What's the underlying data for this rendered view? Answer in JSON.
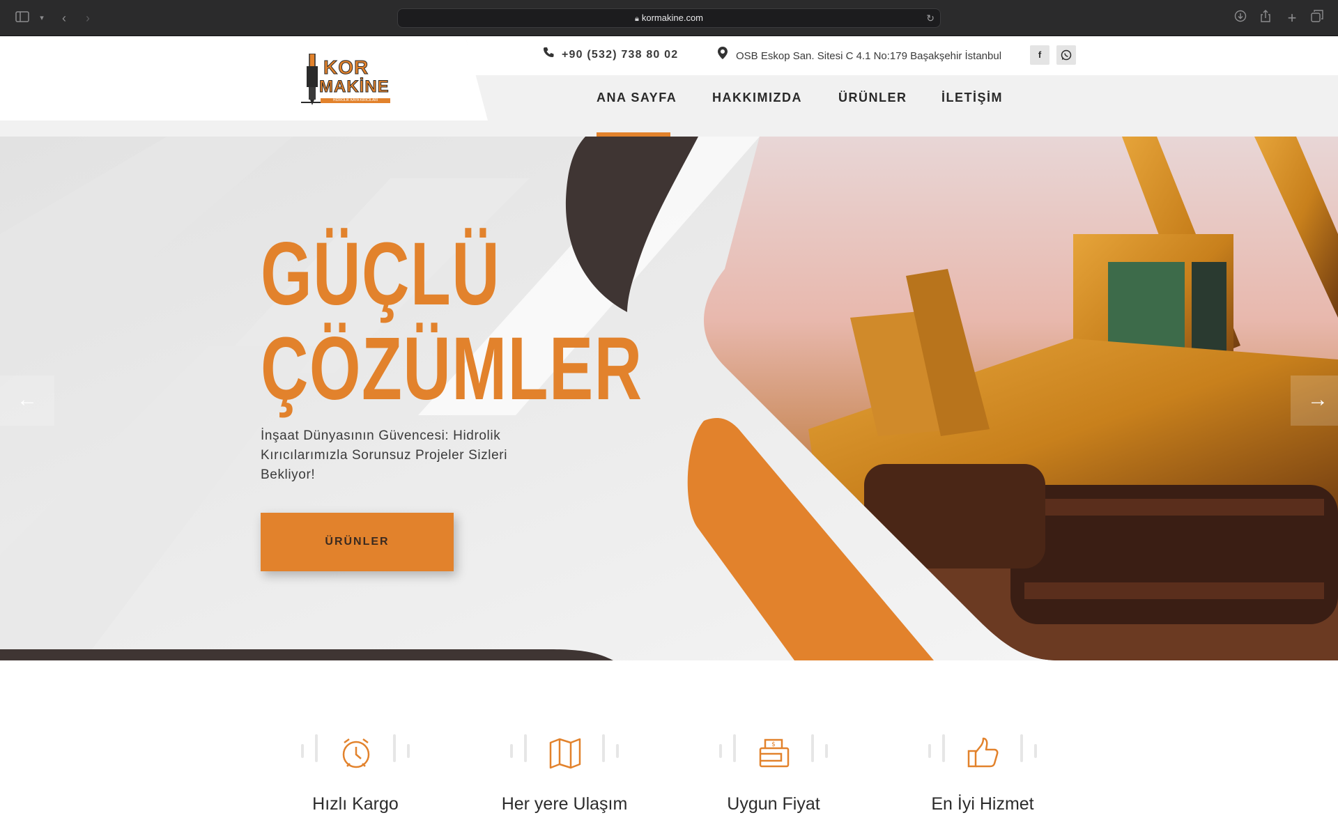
{
  "browser": {
    "url": "kormakine.com"
  },
  "site": {
    "logo": {
      "line1": "KOR",
      "line2": "MAKİNE",
      "tagline": "HİDROLİK KAYA KIRICILARI"
    },
    "topbar": {
      "phone": "+90 (532) 738 80 02",
      "address": "OSB Eskop San. Sitesi C 4.1 No:179 Başakşehir İstanbul",
      "social": [
        "facebook-icon",
        "whatsapp-icon"
      ]
    },
    "nav": {
      "items": [
        {
          "label": "ANA SAYFA",
          "active": true
        },
        {
          "label": "HAKKIMIZDA",
          "active": false
        },
        {
          "label": "ÜRÜNLER",
          "active": false
        },
        {
          "label": "İLETİŞİM",
          "active": false
        }
      ]
    },
    "hero": {
      "title_line1": "GÜÇLÜ",
      "title_line2": "ÇÖZÜMLER",
      "subtitle": "İnşaat Dünyasının Güvencesi: Hidrolik Kırıcılarımızla Sorunsuz Projeler Sizleri Bekliyor!",
      "button": "ÜRÜNLER"
    },
    "features": [
      {
        "icon": "alarm-clock-icon",
        "label": "Hızlı Kargo"
      },
      {
        "icon": "map-icon",
        "label": "Her yere Ulaşım"
      },
      {
        "icon": "wallet-icon",
        "label": "Uygun Fiyat"
      },
      {
        "icon": "thumbs-up-icon",
        "label": "En İyi Hizmet"
      }
    ]
  },
  "colors": {
    "accent": "#e2822c",
    "dark": "#3f3533",
    "text": "#2a2a2a"
  }
}
